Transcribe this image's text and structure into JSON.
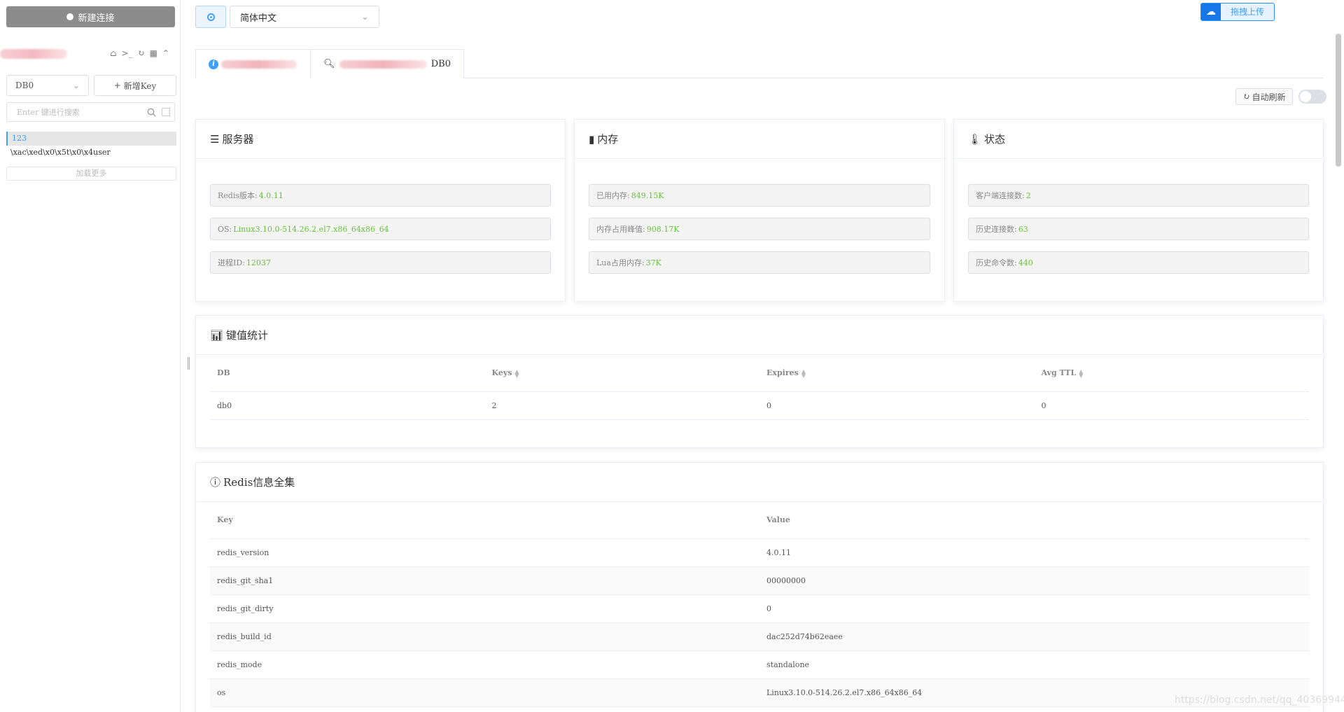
{
  "sidebar": {
    "new_connection": "新建连接",
    "db_selected": "DB0",
    "new_key": "新增Key",
    "search_placeholder": "Enter 键进行搜索",
    "keys": [
      "123",
      "\\xac\\xed\\x0\\x5t\\x0\\x4user"
    ],
    "load_more": "加载更多"
  },
  "topbar": {
    "language": "简体中文",
    "upload_label": "拖拽上传"
  },
  "tabs": [
    {
      "label": ""
    },
    {
      "label": "DB0"
    }
  ],
  "auto_refresh": {
    "label": "自动刷新",
    "enabled": false
  },
  "server_card": {
    "title": "服务器",
    "rows": [
      {
        "label": "Redis版本:",
        "value": "4.0.11"
      },
      {
        "label": "OS:",
        "value": "Linux3.10.0-514.26.2.el7.x86_64x86_64"
      },
      {
        "label": "进程ID:",
        "value": "12037"
      }
    ]
  },
  "memory_card": {
    "title": "内存",
    "rows": [
      {
        "label": "已用内存:",
        "value": "849.15K"
      },
      {
        "label": "内存占用峰值:",
        "value": "908.17K"
      },
      {
        "label": "Lua占用内存:",
        "value": "37K"
      }
    ]
  },
  "status_card": {
    "title": "状态",
    "rows": [
      {
        "label": "客户端连接数:",
        "value": "2"
      },
      {
        "label": "历史连接数:",
        "value": "63"
      },
      {
        "label": "历史命令数:",
        "value": "440"
      }
    ]
  },
  "keystats": {
    "title": "键值统计",
    "columns": [
      "DB",
      "Keys",
      "Expires",
      "Avg TTL"
    ],
    "rows": [
      [
        "db0",
        "2",
        "0",
        "0"
      ]
    ]
  },
  "redis_info": {
    "title": "Redis信息全集",
    "columns": [
      "Key",
      "Value"
    ],
    "rows": [
      [
        "redis_version",
        "4.0.11"
      ],
      [
        "redis_git_sha1",
        "00000000"
      ],
      [
        "redis_git_dirty",
        "0"
      ],
      [
        "redis_build_id",
        "dac252d74b62eaee"
      ],
      [
        "redis_mode",
        "standalone"
      ],
      [
        "os",
        "Linux3.10.0-514.26.2.el7.x86_64x86_64"
      ]
    ]
  },
  "watermark": "https://blog.csdn.net/qq_40369944",
  "colors": {
    "accent": "#409eff",
    "value_green": "#67c23a"
  }
}
